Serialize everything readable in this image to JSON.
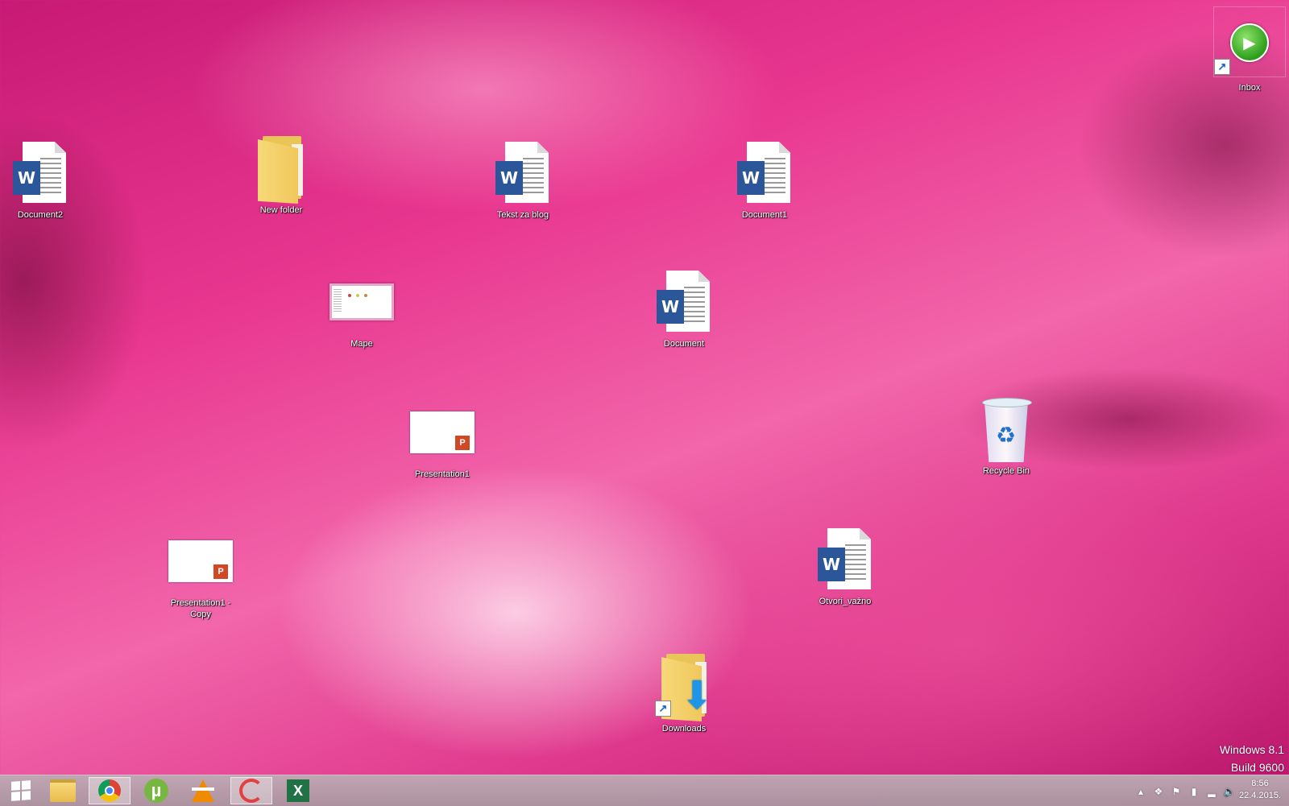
{
  "desktop": {
    "icons": [
      {
        "label": "Document2",
        "type": "word"
      },
      {
        "label": "New folder",
        "type": "folder"
      },
      {
        "label": "Tekst za blog",
        "type": "word"
      },
      {
        "label": "Document1",
        "type": "word"
      },
      {
        "label": "Mape",
        "type": "image"
      },
      {
        "label": "Document",
        "type": "word"
      },
      {
        "label": "Presentation1",
        "type": "powerpoint"
      },
      {
        "label": "Recycle Bin",
        "type": "recycle-bin"
      },
      {
        "label": "Presentation1 - Copy",
        "type": "powerpoint"
      },
      {
        "label": "Otvori_važno",
        "type": "word"
      },
      {
        "label": "Downloads",
        "type": "folder-shortcut"
      },
      {
        "label": "Inbox",
        "type": "shortcut"
      }
    ],
    "word_badge": "W",
    "ppt_badge": "P",
    "watermark": {
      "line1": "Windows 8.1",
      "line2": "Build 9600"
    }
  },
  "taskbar": {
    "apps": [
      {
        "name": "start",
        "icon": "windows-logo-icon"
      },
      {
        "name": "file-explorer",
        "icon": "folder-icon"
      },
      {
        "name": "chrome",
        "icon": "chrome-icon",
        "active": true
      },
      {
        "name": "utorrent",
        "icon": "utorrent-icon",
        "glyph": "µ"
      },
      {
        "name": "vlc",
        "icon": "vlc-cone-icon"
      },
      {
        "name": "ccleaner",
        "icon": "ccleaner-icon",
        "active": true
      },
      {
        "name": "excel",
        "icon": "excel-icon",
        "glyph": "X"
      }
    ],
    "tray": {
      "time": "8:56",
      "date": "22.4.2015."
    }
  },
  "colors": {
    "word": "#2b579a",
    "powerpoint": "#d24726",
    "excel": "#217346",
    "wallpaper_accent": "#e8368f"
  }
}
